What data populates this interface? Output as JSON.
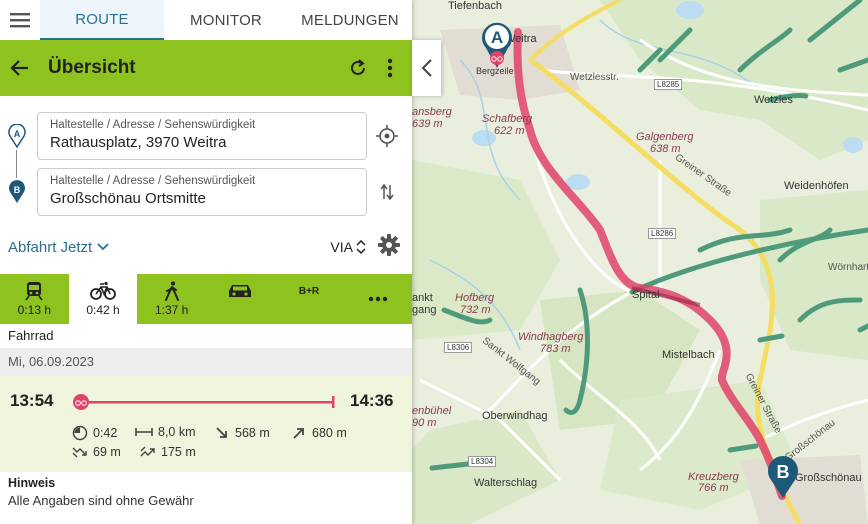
{
  "tabs": [
    {
      "label": "ROUTE",
      "active": true
    },
    {
      "label": "MONITOR",
      "active": false
    },
    {
      "label": "MELDUNGEN",
      "active": false
    }
  ],
  "header": {
    "title": "Übersicht"
  },
  "origin": {
    "pin": "A",
    "placeholder": "Haltestelle / Adresse / Sehenswürdigkeit",
    "value": "Rathausplatz, 3970 Weitra"
  },
  "destination": {
    "pin": "B",
    "placeholder": "Haltestelle / Adresse / Sehenswürdigkeit",
    "value": "Großschönau Ortsmitte"
  },
  "departure": {
    "label": "Abfahrt Jetzt",
    "via_label": "VIA"
  },
  "modes": [
    {
      "icon": "train-icon",
      "duration": "0:13 h",
      "active": false
    },
    {
      "icon": "bicycle-icon",
      "duration": "0:42 h",
      "active": true
    },
    {
      "icon": "walk-icon",
      "duration": "1:37 h",
      "active": false
    },
    {
      "icon": "car-icon",
      "duration": "",
      "active": false
    },
    {
      "icon": "bike-and-ride",
      "label": "B+R",
      "duration": "",
      "active": false
    },
    {
      "icon": "more-icon",
      "duration": "",
      "active": false
    }
  ],
  "mode_caption": "Fahrrad",
  "date": "Mi, 06.09.2023",
  "trip": {
    "depart_time": "13:54",
    "arrive_time": "14:36",
    "duration": "0:42",
    "distance": "8,0 km",
    "descent": "568 m",
    "ascent": "680 m",
    "elev_down_total": "69 m",
    "elev_up_total": "175 m"
  },
  "hint": {
    "title": "Hinweis",
    "text": "Alle Angaben sind ohne Gewähr"
  },
  "colors": {
    "accent_green": "#8dc21f",
    "link_blue": "#2a6f8f",
    "route_red": "#e0426a",
    "marker_blue": "#1d5a7a"
  },
  "map": {
    "markers": [
      {
        "label": "A"
      },
      {
        "label": "B"
      }
    ],
    "places": [
      "Tiefenbach",
      "Weitra",
      "Wetzles",
      "Weidenhöfen",
      "Spital",
      "Mistelbach",
      "Oberwindhag",
      "Walterschlag",
      "Großschönau",
      "Wörnharts",
      "Sankt Wolfgang",
      "Bergzeile",
      "Wetzlesstr.",
      "Großschönau",
      "Greiner Straße"
    ],
    "peaks": [
      {
        "name": "Schafberg",
        "height": "622 m"
      },
      {
        "name": "Galgenberg",
        "height": "638 m"
      },
      {
        "name": "Hofberg",
        "height": "732 m"
      },
      {
        "name": "Windhagberg",
        "height": "783 m"
      },
      {
        "name": "Kreuzberg",
        "height": "766 m"
      }
    ],
    "road_refs": [
      "L8285",
      "L8286",
      "L8306",
      "L8304"
    ],
    "clipped_labels": [
      "ansberg",
      "639 m",
      "ankt",
      "gang",
      "enbühel",
      "90 m"
    ]
  }
}
